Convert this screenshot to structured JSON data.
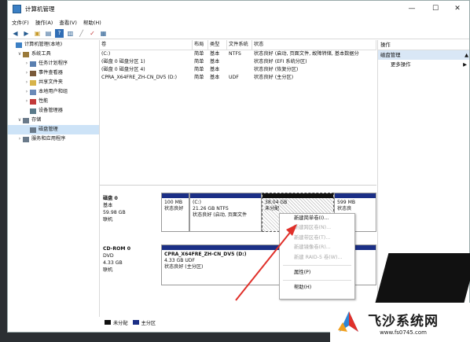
{
  "window": {
    "title": "计算机管理",
    "controls": {
      "minimize": "—",
      "maximize": "☐",
      "close": "✕"
    }
  },
  "menu": [
    "文件(F)",
    "操作(A)",
    "查看(V)",
    "帮助(H)"
  ],
  "tree": [
    {
      "label": "计算机管理(本地)",
      "indent": 0,
      "exp": "",
      "icon": "computer-icon",
      "color": "#3b7fc4"
    },
    {
      "label": "系统工具",
      "indent": 1,
      "exp": "∨",
      "icon": "tools-icon",
      "color": "#9a7a3a"
    },
    {
      "label": "任务计划程序",
      "indent": 2,
      "exp": "›",
      "icon": "clock-icon",
      "color": "#5a7fb0"
    },
    {
      "label": "事件查看器",
      "indent": 2,
      "exp": "›",
      "icon": "event-icon",
      "color": "#7a5a3a"
    },
    {
      "label": "共享文件夹",
      "indent": 2,
      "exp": "›",
      "icon": "folder-icon",
      "color": "#d7b34a"
    },
    {
      "label": "本地用户和组",
      "indent": 2,
      "exp": "›",
      "icon": "users-icon",
      "color": "#6a8ab8"
    },
    {
      "label": "性能",
      "indent": 2,
      "exp": "›",
      "icon": "performance-icon",
      "color": "#c23a3a"
    },
    {
      "label": "设备管理器",
      "indent": 2,
      "exp": "",
      "icon": "device-icon",
      "color": "#5a7a8a"
    },
    {
      "label": "存储",
      "indent": 1,
      "exp": "∨",
      "icon": "storage-icon",
      "color": "#6a7a8a"
    },
    {
      "label": "磁盘管理",
      "indent": 2,
      "exp": "",
      "icon": "disk-icon",
      "color": "#6a7a8a",
      "selected": true
    },
    {
      "label": "服务和应用程序",
      "indent": 1,
      "exp": "›",
      "icon": "services-icon",
      "color": "#6a7a8a"
    }
  ],
  "table": {
    "headers": [
      "卷",
      "布局",
      "类型",
      "文件系统",
      "状态"
    ],
    "rows": [
      [
        "(C:)",
        "简单",
        "基本",
        "NTFS",
        "状态良好 (启动, 页面文件, 故障转储, 基本数据分"
      ],
      [
        "(磁盘 0 磁盘分区 1)",
        "简单",
        "基本",
        "",
        "状态良好 (EFI 系统分区)"
      ],
      [
        "(磁盘 0 磁盘分区 4)",
        "简单",
        "基本",
        "",
        "状态良好 (恢复分区)"
      ],
      [
        "CPRA_X64FRE_ZH-CN_DV5 (D:)",
        "简单",
        "基本",
        "UDF",
        "状态良好 (主分区)"
      ]
    ]
  },
  "disks": [
    {
      "name": "磁盘 0",
      "type": "基本",
      "size": "59.98 GB",
      "status": "联机",
      "partitions": [
        {
          "lines": [
            "100 MB",
            "状态良好"
          ]
        },
        {
          "lines": [
            "(C:)",
            "21.26 GB NTFS",
            "状态良好 (启动, 页面文件"
          ]
        },
        {
          "lines": [
            "38.04 GB",
            "未分配"
          ],
          "unallocated": true
        },
        {
          "lines": [
            "599 MB",
            "状态良"
          ]
        }
      ]
    },
    {
      "name": "CD-ROM 0",
      "type": "DVD",
      "size": "4.33 GB",
      "status": "联机",
      "partitions": [
        {
          "lines": [
            "CPRA_X64FRE_ZH-CN_DV5 (D:)",
            "4.33 GB UDF",
            "状态良好 (主分区)"
          ]
        }
      ]
    }
  ],
  "legend": [
    {
      "label": "未分配",
      "color": "#111111"
    },
    {
      "label": "主分区",
      "color": "#1b2f86"
    }
  ],
  "operations": {
    "header": "操作",
    "section": "磁盘管理",
    "section_arrow": "▲",
    "more": "更多操作",
    "more_arrow": "▶"
  },
  "context_menu": [
    {
      "label": "新建简单卷(I)...",
      "disabled": false
    },
    {
      "label": "新建跨区卷(N)...",
      "disabled": true
    },
    {
      "label": "新建带区卷(T)...",
      "disabled": true
    },
    {
      "label": "新建镜像卷(R)...",
      "disabled": true
    },
    {
      "label": "新建 RAID-5 卷(W)...",
      "disabled": true
    },
    {
      "sep": true
    },
    {
      "label": "属性(P)",
      "disabled": false
    },
    {
      "sep": true
    },
    {
      "label": "帮助(H)",
      "disabled": false
    }
  ],
  "watermark": {
    "brand": "飞沙系统网",
    "url": "www.fs0745.com"
  },
  "colors": {
    "primary_partition": "#1b2f86",
    "selection": "#cde3f7",
    "arrow": "#e0302a"
  }
}
